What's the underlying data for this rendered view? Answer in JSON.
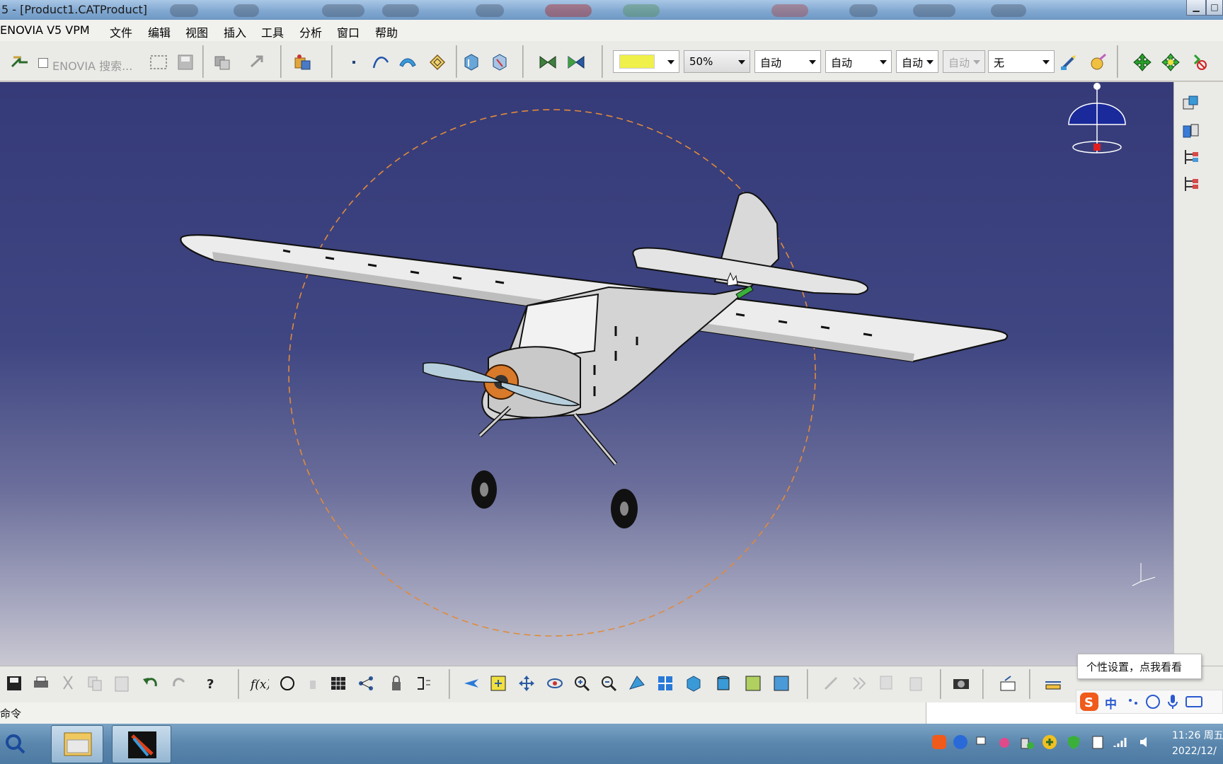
{
  "window": {
    "title": "5 - [Product1.CATProduct]"
  },
  "menu": {
    "items": [
      "ENOVIA V5 VPM",
      "文件",
      "编辑",
      "视图",
      "插入",
      "工具",
      "分析",
      "窗口",
      "帮助"
    ]
  },
  "toolbar_top": {
    "enovia_search": "ENOVIA 搜索...",
    "color_swatch": "#f0f04a",
    "transparency": "50%",
    "line_width": "自动",
    "line_type": "自动",
    "point_style": "自动",
    "layer_disabled": "自动",
    "layer": "无"
  },
  "status": {
    "command_label": "命令"
  },
  "tooltip": {
    "text": "个性设置，点我看看"
  },
  "ime": {
    "lang": "中"
  },
  "taskbar": {
    "time": "11:26 周五",
    "date": "2022/12/"
  },
  "colors": {
    "viewport_top": "#353a78",
    "viewport_bottom": "#c9c8d2",
    "selection_circle": "#e08a3c"
  }
}
